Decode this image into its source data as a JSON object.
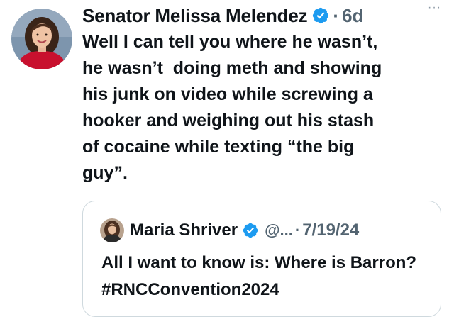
{
  "tweet": {
    "author_name": "Senator Melissa Melendez",
    "separator": "·",
    "time": "6d",
    "more_label": "···",
    "text": "Well I can tell you where he wasn’t,\nhe wasn’t  doing meth and showing\nhis junk on video while screwing a\nhooker and weighing out his stash\nof cocaine while texting “the big\nguy”.",
    "icons": {
      "verified": "verified-badge-icon",
      "more": "more-options-icon"
    }
  },
  "quote": {
    "author_name": "Maria Shriver",
    "handle": "@...",
    "separator": "·",
    "date": "7/19/24",
    "text": "All I want to know is: Where is Barron? #RNCConvention2024"
  },
  "colors": {
    "text": "#0f1419",
    "secondary": "#536471",
    "verified_blue": "#1d9bf0",
    "border": "#cfd9de"
  }
}
